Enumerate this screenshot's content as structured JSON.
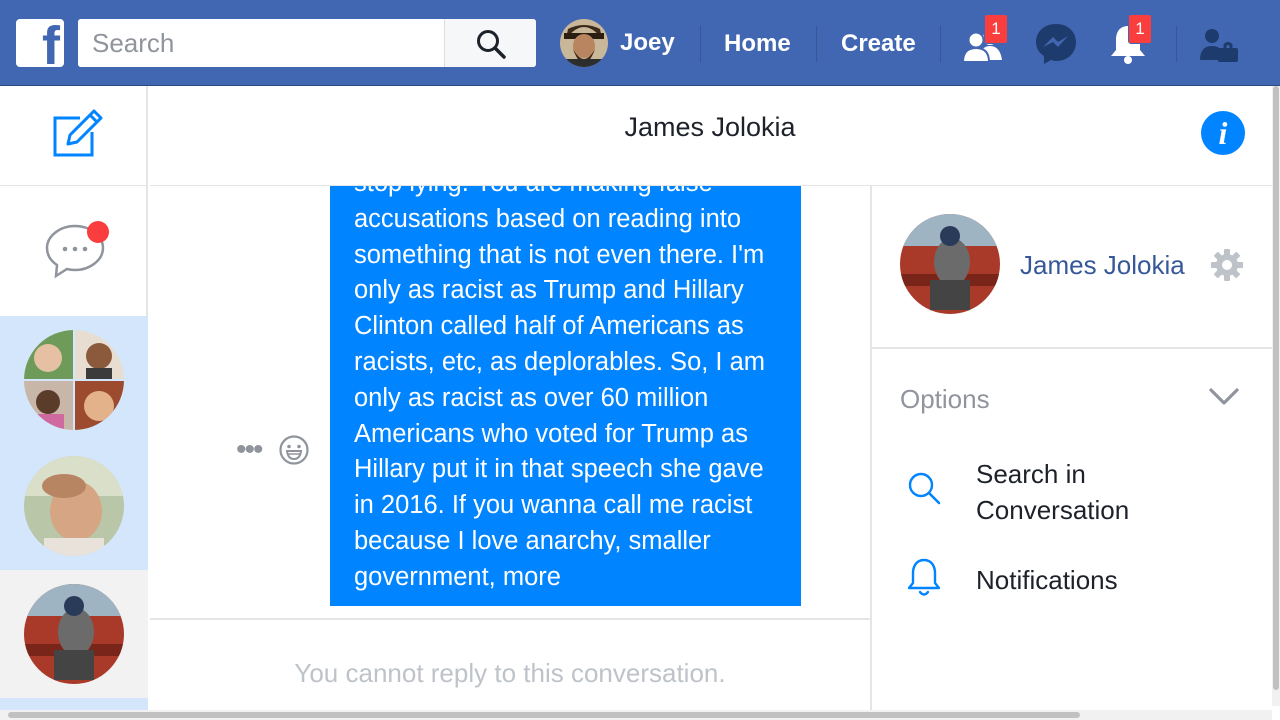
{
  "topbar": {
    "logo_icon": "facebook-f-logo",
    "search": {
      "placeholder": "Search",
      "value": ""
    },
    "user_name": "Joey",
    "home_label": "Home",
    "create_label": "Create",
    "friend_requests_badge": "1",
    "notifications_badge": "1"
  },
  "conversation": {
    "title": "James Jolokia",
    "message_text": "stop lying. You are making false accusations based on reading into something that is not even there. I'm only as racist as Trump and Hillary Clinton called half of Americans as racists, etc, as deplorables. So, I am only as racist as over 60 million Americans who voted for Trump as Hillary put it in that speech she gave in 2016. If you wanna call me racist because I love anarchy, smaller government, more",
    "footer_text": "You cannot reply to this conversation."
  },
  "right_panel": {
    "name": "James Jolokia",
    "options_label": "Options",
    "items": [
      {
        "label": "Search in Conversation",
        "icon": "search-icon"
      },
      {
        "label": "Notifications",
        "icon": "bell-icon"
      }
    ]
  },
  "colors": {
    "brand_blue": "#4267b2",
    "messenger_blue": "#0084ff",
    "badge_red": "#fa3e3e",
    "selected_bg": "#d4e6fc"
  }
}
